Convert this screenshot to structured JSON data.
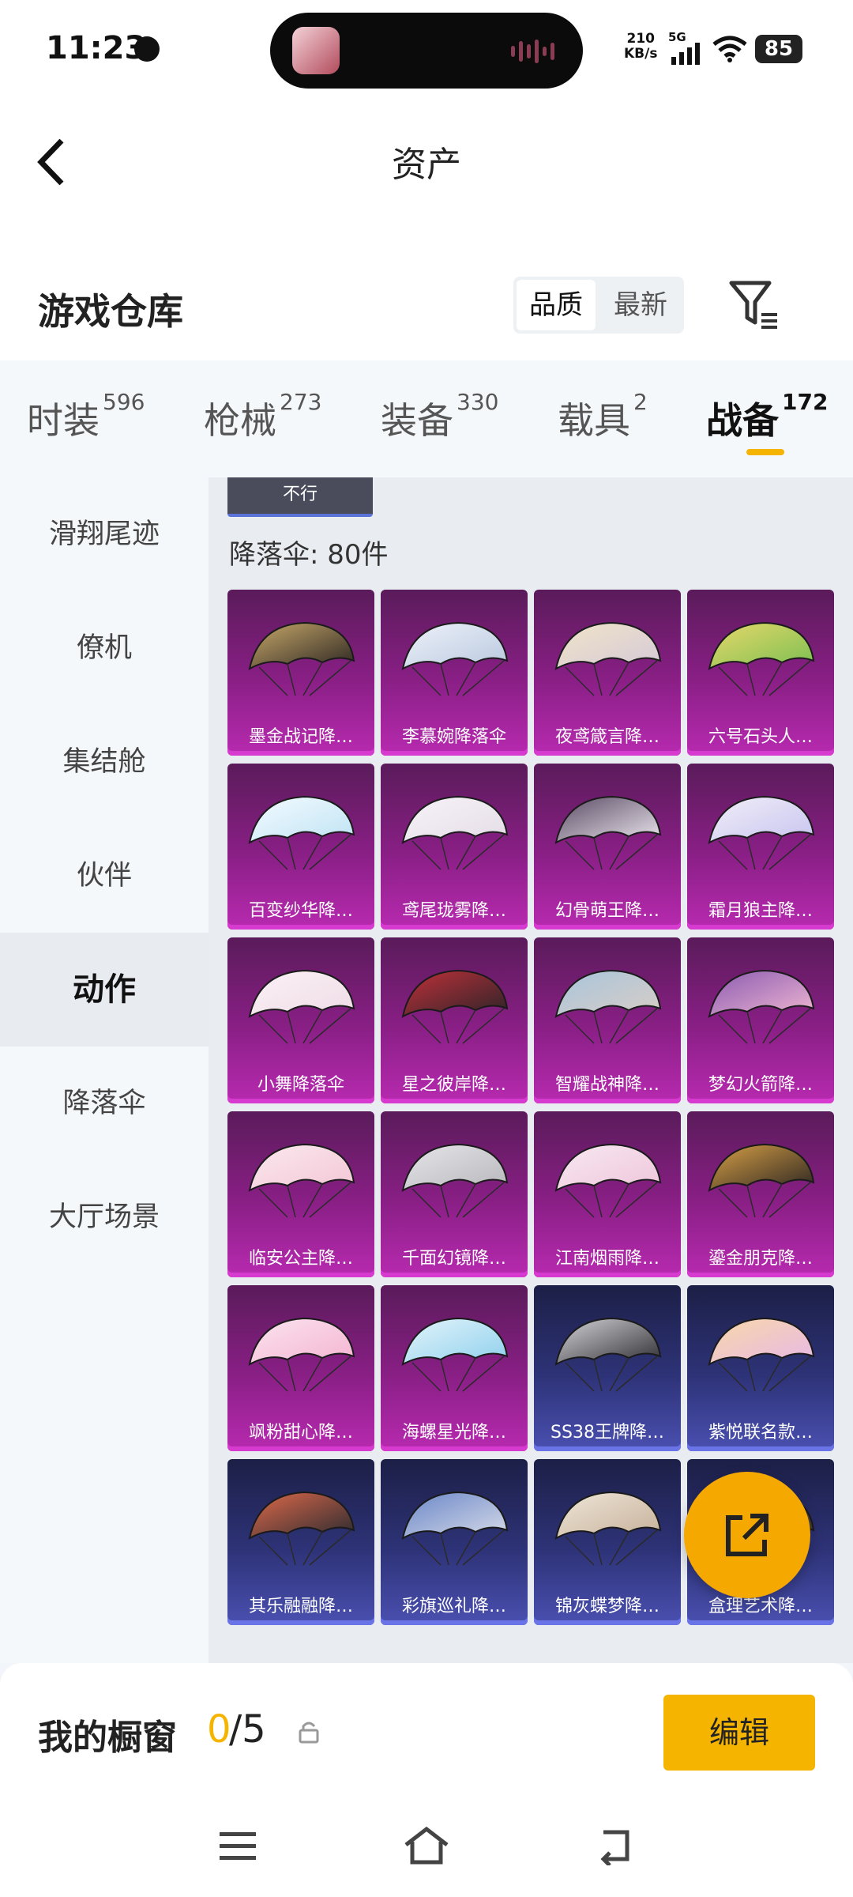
{
  "status_bar": {
    "time": "11:23",
    "net_speed_value": "210",
    "net_speed_unit": "KB/s",
    "network": "5G",
    "battery": "85"
  },
  "header": {
    "title": "资产"
  },
  "warehouse": {
    "title": "游戏仓库",
    "sort_quality": "品质",
    "sort_newest": "最新"
  },
  "tabs": [
    {
      "label": "时装",
      "count": "596"
    },
    {
      "label": "枪械",
      "count": "273"
    },
    {
      "label": "装备",
      "count": "330"
    },
    {
      "label": "载具",
      "count": "2"
    },
    {
      "label": "战备",
      "count": "172",
      "active": true
    }
  ],
  "sidebar": {
    "items": [
      {
        "label": "滑翔尾迹"
      },
      {
        "label": "僚机"
      },
      {
        "label": "集结舱"
      },
      {
        "label": "伙伴"
      },
      {
        "label": "动作",
        "active": true
      },
      {
        "label": "降落伞"
      },
      {
        "label": "大厅场景"
      }
    ]
  },
  "content": {
    "status_chip": "不行",
    "count_label": "降落伞: 80件",
    "items": [
      {
        "name": "墨金战记降…",
        "rarity": "purple"
      },
      {
        "name": "李慕婉降落伞",
        "rarity": "purple"
      },
      {
        "name": "夜鸢箴言降…",
        "rarity": "purple"
      },
      {
        "name": "六号石头人…",
        "rarity": "purple"
      },
      {
        "name": "百变纱华降…",
        "rarity": "purple"
      },
      {
        "name": "鸢尾珑雾降…",
        "rarity": "purple"
      },
      {
        "name": "幻骨萌王降…",
        "rarity": "purple"
      },
      {
        "name": "霜月狼主降…",
        "rarity": "purple"
      },
      {
        "name": "小舞降落伞",
        "rarity": "purple"
      },
      {
        "name": "星之彼岸降…",
        "rarity": "purple"
      },
      {
        "name": "智耀战神降…",
        "rarity": "purple"
      },
      {
        "name": "梦幻火箭降…",
        "rarity": "purple"
      },
      {
        "name": "临安公主降…",
        "rarity": "purple"
      },
      {
        "name": "千面幻镜降…",
        "rarity": "purple"
      },
      {
        "name": "江南烟雨降…",
        "rarity": "purple"
      },
      {
        "name": "鎏金朋克降…",
        "rarity": "purple"
      },
      {
        "name": "飒粉甜心降…",
        "rarity": "purple"
      },
      {
        "name": "海螺星光降…",
        "rarity": "purple"
      },
      {
        "name": "SS38王牌降…",
        "rarity": "blue"
      },
      {
        "name": "紫悦联名款…",
        "rarity": "blue"
      },
      {
        "name": "其乐融融降…",
        "rarity": "blue"
      },
      {
        "name": "彩旗巡礼降…",
        "rarity": "blue"
      },
      {
        "name": "锦灰蝶梦降…",
        "rarity": "blue"
      },
      {
        "name": "盒理艺术降…",
        "rarity": "blue"
      }
    ]
  },
  "showcase": {
    "label": "我的橱窗",
    "used": "0",
    "total": "/5",
    "edit_label": "编辑"
  },
  "colors": {
    "accent": "#f5b400",
    "purple_rarity": "#b82ab0",
    "blue_rarity": "#4a50b0"
  }
}
